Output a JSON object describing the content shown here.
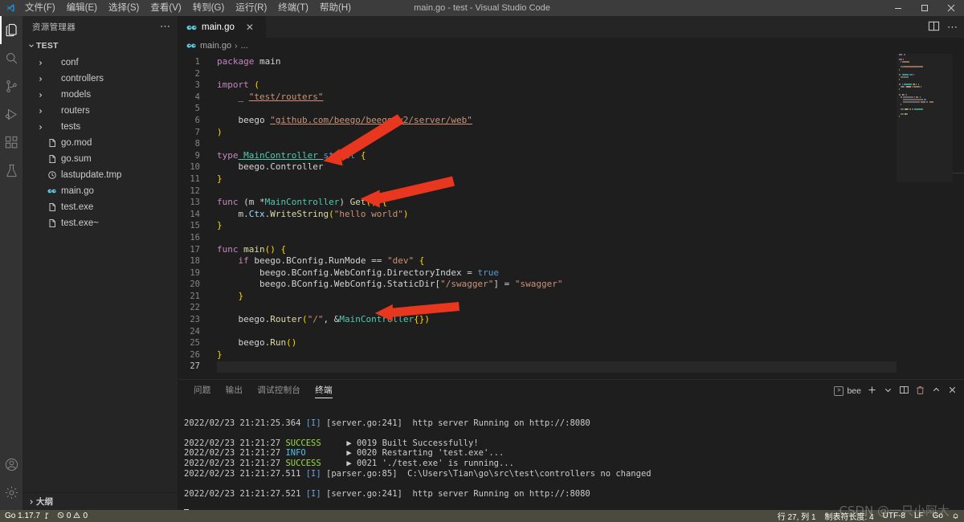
{
  "window": {
    "title": "main.go - test - Visual Studio Code",
    "minimize": "─",
    "maximize": "□",
    "close": "✕"
  },
  "menu": {
    "items": [
      {
        "label": "文件(F)",
        "name": "menu-file"
      },
      {
        "label": "编辑(E)",
        "name": "menu-edit"
      },
      {
        "label": "选择(S)",
        "name": "menu-selection"
      },
      {
        "label": "查看(V)",
        "name": "menu-view"
      },
      {
        "label": "转到(G)",
        "name": "menu-go"
      },
      {
        "label": "运行(R)",
        "name": "menu-run"
      },
      {
        "label": "终端(T)",
        "name": "menu-terminal"
      },
      {
        "label": "帮助(H)",
        "name": "menu-help"
      }
    ]
  },
  "activitybar": {
    "top": [
      {
        "name": "explorer-icon",
        "active": true
      },
      {
        "name": "search-icon",
        "active": false
      },
      {
        "name": "source-control-icon",
        "active": false
      },
      {
        "name": "run-debug-icon",
        "active": false
      },
      {
        "name": "extensions-icon",
        "active": false
      },
      {
        "name": "testing-icon",
        "active": false
      }
    ],
    "bottom": [
      {
        "name": "account-icon"
      },
      {
        "name": "settings-gear-icon"
      }
    ]
  },
  "sidebar": {
    "header": "资源管理器",
    "more": "⋯",
    "root": "TEST",
    "outline": "大纲",
    "items": [
      {
        "label": "conf",
        "type": "folder",
        "icon": "folder-icon"
      },
      {
        "label": "controllers",
        "type": "folder",
        "icon": "folder-icon"
      },
      {
        "label": "models",
        "type": "folder",
        "icon": "folder-icon"
      },
      {
        "label": "routers",
        "type": "folder",
        "icon": "folder-icon"
      },
      {
        "label": "tests",
        "type": "folder",
        "icon": "folder-icon"
      },
      {
        "label": "go.mod",
        "type": "file",
        "icon": "file-icon"
      },
      {
        "label": "go.sum",
        "type": "file",
        "icon": "file-icon"
      },
      {
        "label": "lastupdate.tmp",
        "type": "file",
        "icon": "clock-icon"
      },
      {
        "label": "main.go",
        "type": "file",
        "icon": "go-icon"
      },
      {
        "label": "test.exe",
        "type": "file",
        "icon": "file-icon"
      },
      {
        "label": "test.exe~",
        "type": "file",
        "icon": "file-icon"
      }
    ]
  },
  "editor": {
    "tab": {
      "label": "main.go",
      "close": "✕",
      "icon": "go-icon"
    },
    "breadcrumb": {
      "file": "main.go",
      "separator": "›",
      "tail": "..."
    },
    "actions": [
      "split-editor-icon",
      "more-actions-icon"
    ],
    "lines": [
      {
        "n": 1,
        "tokens": [
          [
            "kw",
            "package"
          ],
          [
            "id",
            " main"
          ]
        ]
      },
      {
        "n": 2,
        "tokens": []
      },
      {
        "n": 3,
        "tokens": [
          [
            "kw",
            "import"
          ],
          [
            "punct",
            " ("
          ]
        ]
      },
      {
        "n": 4,
        "tokens": [
          [
            "id",
            "    _ "
          ],
          [
            "str ul",
            "\"test/routers\""
          ]
        ]
      },
      {
        "n": 5,
        "tokens": []
      },
      {
        "n": 6,
        "tokens": [
          [
            "id",
            "    beego "
          ],
          [
            "str ul",
            "\"github.com/beego/beego/v2/server/web\""
          ]
        ]
      },
      {
        "n": 7,
        "tokens": [
          [
            "punct",
            ")"
          ]
        ]
      },
      {
        "n": 8,
        "tokens": []
      },
      {
        "n": 9,
        "tokens": [
          [
            "kw",
            "type"
          ],
          [
            "typ ul",
            " MainController "
          ],
          [
            "kw2",
            "struct"
          ],
          [
            "punct",
            " {"
          ]
        ]
      },
      {
        "n": 10,
        "tokens": [
          [
            "id",
            "    beego.Controller"
          ]
        ]
      },
      {
        "n": 11,
        "tokens": [
          [
            "punct",
            "}"
          ]
        ]
      },
      {
        "n": 12,
        "tokens": []
      },
      {
        "n": 13,
        "tokens": [
          [
            "kw",
            "func"
          ],
          [
            "id",
            " (m "
          ],
          [
            "op",
            "*"
          ],
          [
            "typ",
            "MainController"
          ],
          [
            "id",
            ") "
          ],
          [
            "fn",
            "Get"
          ],
          [
            "punct",
            "()"
          ],
          [
            "punct",
            " {"
          ]
        ]
      },
      {
        "n": 14,
        "tokens": [
          [
            "id",
            "    m."
          ],
          [
            "var",
            "Ctx"
          ],
          [
            "id",
            "."
          ],
          [
            "fn",
            "WriteString"
          ],
          [
            "punct",
            "("
          ],
          [
            "str",
            "\"hello world\""
          ],
          [
            "punct",
            ")"
          ]
        ]
      },
      {
        "n": 15,
        "tokens": [
          [
            "punct",
            "}"
          ]
        ]
      },
      {
        "n": 16,
        "tokens": []
      },
      {
        "n": 17,
        "tokens": [
          [
            "kw",
            "func"
          ],
          [
            "fn",
            " main"
          ],
          [
            "punct",
            "()"
          ],
          [
            "punct",
            " {"
          ]
        ]
      },
      {
        "n": 18,
        "tokens": [
          [
            "kw",
            "    if"
          ],
          [
            "id",
            " beego.BConfig.RunMode "
          ],
          [
            "op",
            "=="
          ],
          [
            "str",
            " \"dev\""
          ],
          [
            "punct",
            " {"
          ]
        ]
      },
      {
        "n": 19,
        "tokens": [
          [
            "id",
            "        beego.BConfig.WebConfig.DirectoryIndex "
          ],
          [
            "op",
            "="
          ],
          [
            "kw2",
            " true"
          ]
        ]
      },
      {
        "n": 20,
        "tokens": [
          [
            "id",
            "        beego.BConfig.WebConfig.StaticDir["
          ],
          [
            "str",
            "\"/swagger\""
          ],
          [
            "id",
            "] "
          ],
          [
            "op",
            "="
          ],
          [
            "str",
            " \"swagger\""
          ]
        ]
      },
      {
        "n": 21,
        "tokens": [
          [
            "punct",
            "    }"
          ]
        ]
      },
      {
        "n": 22,
        "tokens": []
      },
      {
        "n": 23,
        "tokens": [
          [
            "id",
            "    beego."
          ],
          [
            "fn",
            "Router"
          ],
          [
            "punct",
            "("
          ],
          [
            "str",
            "\"/\""
          ],
          [
            "id",
            ", "
          ],
          [
            "op",
            "&"
          ],
          [
            "typ",
            "MainController"
          ],
          [
            "punct",
            "{})"
          ]
        ]
      },
      {
        "n": 24,
        "tokens": []
      },
      {
        "n": 25,
        "tokens": [
          [
            "id",
            "    beego."
          ],
          [
            "fn",
            "Run"
          ],
          [
            "punct",
            "()"
          ]
        ]
      },
      {
        "n": 26,
        "tokens": [
          [
            "punct",
            "}"
          ]
        ]
      },
      {
        "n": 27,
        "tokens": []
      }
    ]
  },
  "panel": {
    "tabs": [
      {
        "label": "问题",
        "name": "tab-problems",
        "active": false
      },
      {
        "label": "输出",
        "name": "tab-output",
        "active": false
      },
      {
        "label": "调试控制台",
        "name": "tab-debug-console",
        "active": false
      },
      {
        "label": "终端",
        "name": "tab-terminal",
        "active": true
      }
    ],
    "terminal_name": "bee",
    "actions": [
      {
        "name": "new-terminal-icon",
        "glyph": "+"
      },
      {
        "name": "chevron-down-icon",
        "glyph": "⌄"
      },
      {
        "name": "split-terminal-icon",
        "glyph": "◫"
      },
      {
        "name": "kill-terminal-icon",
        "glyph": "🗑"
      },
      {
        "name": "maximize-panel-icon",
        "glyph": "⌃"
      },
      {
        "name": "close-panel-icon",
        "glyph": "✕"
      }
    ],
    "terminal_lines": [
      {
        "type": "blank"
      },
      {
        "type": "log",
        "ts": "2022/02/23 21:21:25.364 ",
        "level": "[I]",
        "levelclass": "t-i",
        "rest": " [server.go:241]  http server Running on http://:8080"
      },
      {
        "type": "blank"
      },
      {
        "type": "bee",
        "ts": "2022/02/23 21:21:27 ",
        "level": "SUCCESS",
        "levelclass": "t-success",
        "pad": "  ",
        "arrow": "▶",
        "rest": " 0019 Built Successfully!"
      },
      {
        "type": "bee",
        "ts": "2022/02/23 21:21:27 ",
        "level": "INFO",
        "levelclass": "t-info",
        "pad": "     ",
        "arrow": "▶",
        "rest": " 0020 Restarting 'test.exe'..."
      },
      {
        "type": "bee",
        "ts": "2022/02/23 21:21:27 ",
        "level": "SUCCESS",
        "levelclass": "t-success",
        "pad": "  ",
        "arrow": "▶",
        "rest": " 0021 './test.exe' is running..."
      },
      {
        "type": "log",
        "ts": "2022/02/23 21:21:27.511 ",
        "level": "[I]",
        "levelclass": "t-i",
        "rest": " [parser.go:85]  C:\\Users\\Tian\\go\\src\\test\\controllers no changed"
      },
      {
        "type": "blank"
      },
      {
        "type": "log",
        "ts": "2022/02/23 21:21:27.521 ",
        "level": "[I]",
        "levelclass": "t-i",
        "rest": " [server.go:241]  http server Running on http://:8080"
      },
      {
        "type": "blank"
      },
      {
        "type": "prompt"
      }
    ]
  },
  "statusbar": {
    "left": [
      {
        "name": "go-version",
        "label": "Go 1.17.7",
        "icon": "go-branch-icon"
      },
      {
        "name": "problems-counts",
        "errors": "0",
        "warnings": "0"
      }
    ],
    "right": [
      {
        "name": "cursor-position",
        "label": "行 27, 列 1"
      },
      {
        "name": "indentation",
        "label": "制表符长度: 4"
      },
      {
        "name": "encoding",
        "label": "UTF-8"
      },
      {
        "name": "eol",
        "label": "LF"
      },
      {
        "name": "language-mode",
        "label": "Go"
      },
      {
        "name": "notifications-bell",
        "label": ""
      }
    ]
  },
  "watermark": "CSDN @一只小阿大",
  "colors": {
    "titlebar": "#3c3c3c",
    "activitybar": "#333333",
    "sidebar": "#252526",
    "editor": "#1e1e1e",
    "statusbar": "#4a4a3f",
    "accent": "#007acc",
    "arrow": "#e8361f"
  }
}
